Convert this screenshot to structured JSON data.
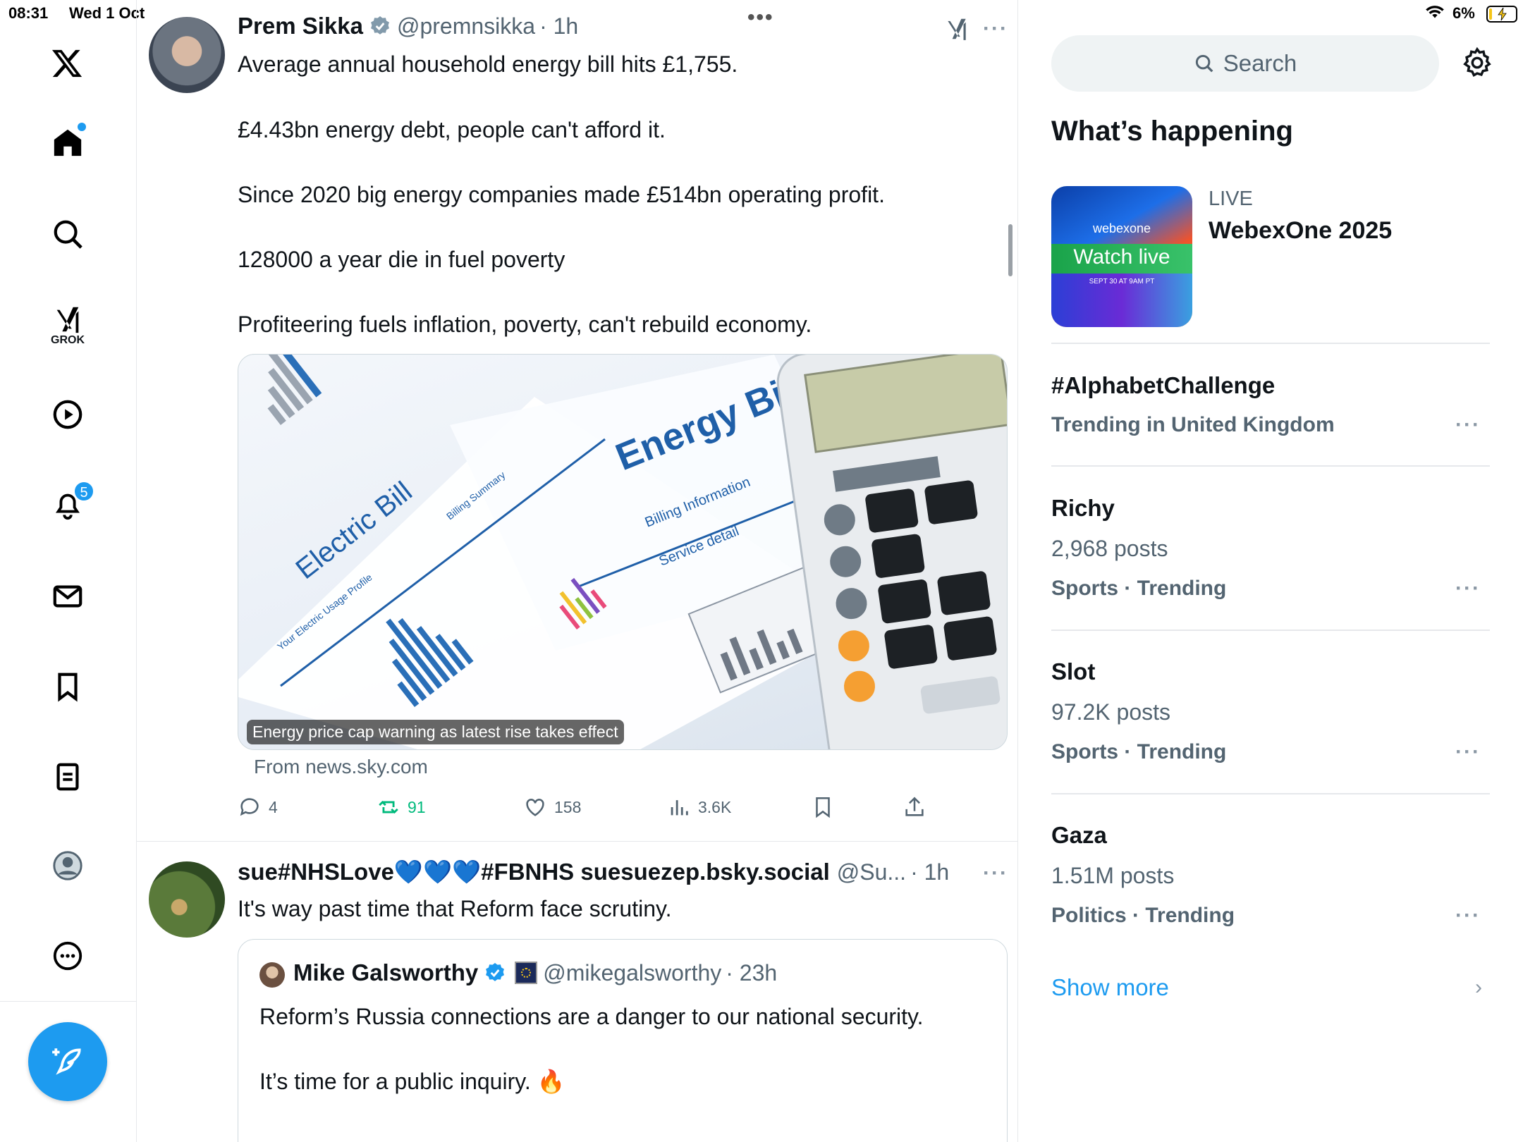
{
  "status_bar": {
    "time": "08:31",
    "date": "Wed 1 Oct",
    "battery": "6%"
  },
  "nav": {
    "grok_label": "GROK",
    "notifications_count": "5"
  },
  "tweet1": {
    "author": "Prem Sikka",
    "handle": "@premnsikka",
    "time": "· 1h",
    "lines": [
      "Average annual household energy bill hits £1,755.",
      "£4.43bn energy debt, people can't afford it.",
      "Since 2020 big energy companies made £514bn operating profit.",
      "128000 a year die in fuel poverty",
      "Profiteering fuels inflation, poverty, can't rebuild economy."
    ],
    "card_caption": "Energy price cap warning as latest rise takes effect",
    "card_source": "From news.sky.com",
    "image_text": {
      "electric_bill": "Electric Bill",
      "energy_bill": "Energy Bill",
      "billing_info": "Billing Information",
      "service_detail": "Service detail",
      "billing_summary": "Billing Summary",
      "usage_profile": "Your Electric Usage Profile"
    },
    "stats": {
      "replies": "4",
      "reposts": "91",
      "likes": "158",
      "views": "3.6K"
    }
  },
  "tweet2": {
    "author": "sue#NHSLove💙💙💙#FBNHS suesuezep.bsky.social",
    "handle": "@Su...",
    "time": "· 1h",
    "text": "It's way past time that Reform face scrutiny.",
    "quote": {
      "author": "Mike Galsworthy",
      "handle": "@mikegalsworthy",
      "time": "· 23h",
      "line1": "Reform’s Russia connections are a danger to our national security.",
      "line2": "It’s time for a public inquiry. 🔥"
    }
  },
  "sidebar": {
    "search_placeholder": "Search",
    "heading": "What’s happening",
    "live": {
      "label": "LIVE",
      "title": "WebexOne 2025",
      "thumb_brand": "webexone",
      "thumb_watch": "Watch live",
      "thumb_date": "SEPT 30 AT 9AM PT"
    },
    "trends": [
      {
        "title": "#AlphabetChallenge",
        "posts": "",
        "category": "Trending in United Kingdom"
      },
      {
        "title": "Richy",
        "posts": "2,968 posts",
        "category": "Sports · Trending"
      },
      {
        "title": "Slot",
        "posts": "97.2K posts",
        "category": "Sports · Trending"
      },
      {
        "title": "Gaza",
        "posts": "1.51M posts",
        "category": "Politics · Trending"
      }
    ],
    "show_more": "Show more"
  }
}
